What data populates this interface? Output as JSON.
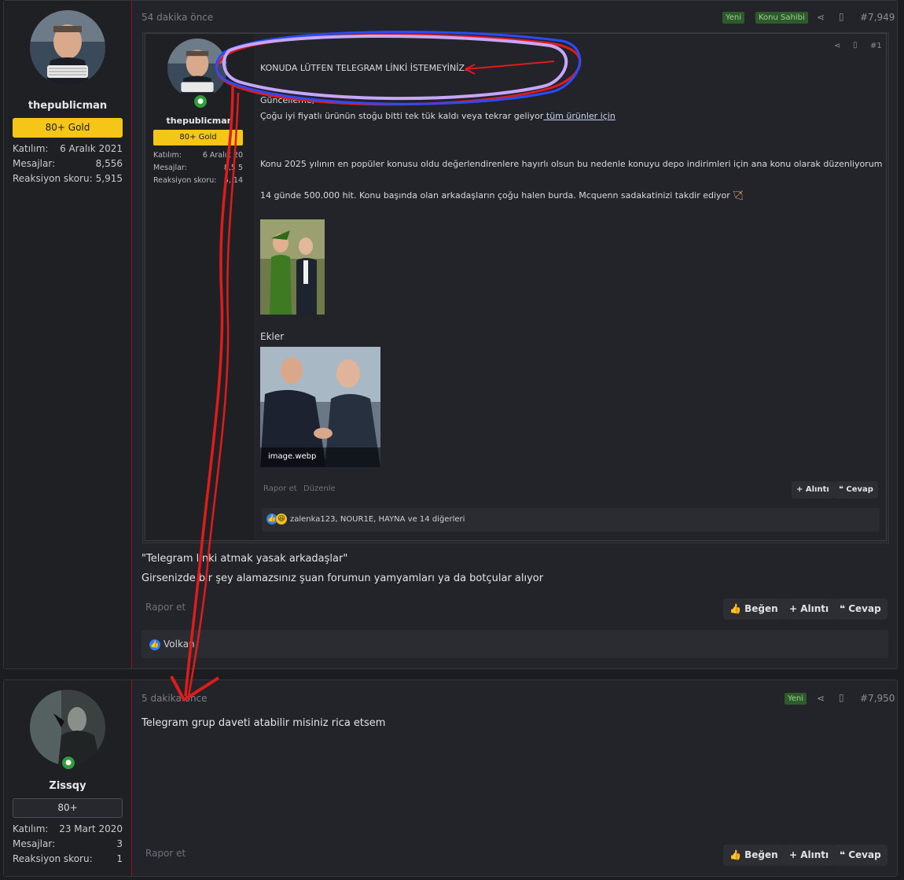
{
  "post1": {
    "user": {
      "name": "thepublicman",
      "badge": "80+ Gold",
      "stats": [
        {
          "k": "Katılım:",
          "v": "6 Aralık 2021"
        },
        {
          "k": "Mesajlar:",
          "v": "8,556"
        },
        {
          "k": "Reaksiyon skoru:",
          "v": "5,915"
        }
      ]
    },
    "time": "54 dakika önce",
    "tags": [
      "Yeni",
      "Konu Sahibi"
    ],
    "post_number": "#7,949",
    "quote": {
      "user": {
        "name": "thepublicman",
        "badge": "80+ Gold",
        "stats": [
          {
            "k": "Katılım:",
            "v": "6 Aralık 20"
          },
          {
            "k": "Mesajlar:",
            "v": "8,5 5"
          },
          {
            "k": "Reaksiyon skoru:",
            "v": "5, 14"
          }
        ]
      },
      "post_number": "#1",
      "line1": "KONUDA LÜTFEN TELEGRAM LİNKİ İSTEMEYİNİZ.",
      "line2": "Güncelleme;",
      "line3a": "Çoğu iyi fiyatlı ürünün stoğu bitti tek tük kaldı veya tekrar geliyor",
      "line3b": " tüm ürünler için",
      "line4": "Konu 2025 yılının en popüler konusu oldu değerlendirenlere hayırlı olsun bu nedenle konuyu depo indirimleri için ana konu olarak düzenliyorum",
      "line5": "14 günde 500.000 hit. Konu başında olan arkadaşların çoğu halen burda. Mcquenn sadakatinizi takdir ediyor",
      "attachments_label": "Ekler",
      "attachment_name": "image.webp",
      "rapor": "Rapor et",
      "duzenle": "Düzenle",
      "alinti": "Alıntı",
      "cevap": "Cevap",
      "reactions": "zalenka123, NOUR1E, HAYNA ve 14 diğerleri"
    },
    "body1": "\"Telegram linki atmak yasak arkadaşlar\"",
    "body2": "Girsenizde bir şey alamazsınız şuan forumun yamyamları ya da botçular alıyor",
    "rapor": "Rapor et",
    "begen": "Beğen",
    "alinti": "Alıntı",
    "cevap": "Cevap",
    "reactions": "Volkan"
  },
  "post2": {
    "user": {
      "name": "Zissqy",
      "badge": "80+",
      "stats": [
        {
          "k": "Katılım:",
          "v": "23 Mart 2020"
        },
        {
          "k": "Mesajlar:",
          "v": "3"
        },
        {
          "k": "Reaksiyon skoru:",
          "v": "1"
        }
      ]
    },
    "time": "5 dakika önce",
    "tags": [
      "Yeni"
    ],
    "post_number": "#7,950",
    "body": "Telegram grup daveti atabilir misiniz rica etsem",
    "rapor": "Rapor et",
    "begen": "Beğen",
    "alinti": "Alıntı",
    "cevap": "Cevap"
  },
  "colors": {
    "gold": "#f5c518",
    "accent_red": "#e01b1b",
    "annotation_purple": "#c7a6ff",
    "annotation_blue": "#2a4bff"
  }
}
